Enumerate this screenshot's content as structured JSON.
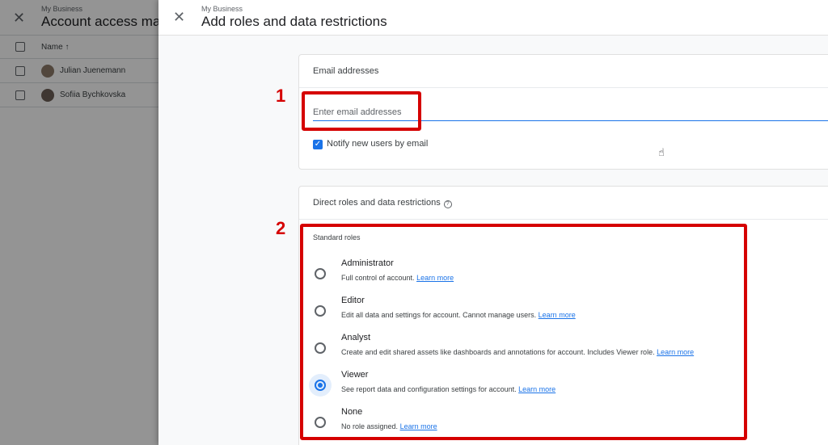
{
  "background": {
    "breadcrumb": "My Business",
    "title": "Account access mar",
    "table": {
      "column_name": "Name ↑",
      "rows": [
        {
          "name": "Julian Juenemann"
        },
        {
          "name": "Sofiia Bychkovska"
        }
      ]
    }
  },
  "drawer": {
    "breadcrumb": "My Business",
    "title": "Add roles and data restrictions",
    "email_section": {
      "heading": "Email addresses",
      "placeholder": "Enter email addresses",
      "notify_label": "Notify new users by email",
      "notify_checked": true
    },
    "roles_section": {
      "heading": "Direct roles and data restrictions",
      "standard_label": "Standard roles",
      "learn_more": "Learn more",
      "roles": [
        {
          "name": "Administrator",
          "desc": "Full control of account.",
          "selected": false
        },
        {
          "name": "Editor",
          "desc": "Edit all data and settings for account. Cannot manage users.",
          "selected": false
        },
        {
          "name": "Analyst",
          "desc": "Create and edit shared assets like dashboards and annotations for account. Includes Viewer role.",
          "selected": false
        },
        {
          "name": "Viewer",
          "desc": "See report data and configuration settings for account.",
          "selected": true
        },
        {
          "name": "None",
          "desc": "No role assigned.",
          "selected": false
        }
      ]
    }
  },
  "annotations": {
    "step1": "1",
    "step2": "2"
  },
  "colors": {
    "accent": "#1a73e8",
    "annotation": "#d50000"
  }
}
